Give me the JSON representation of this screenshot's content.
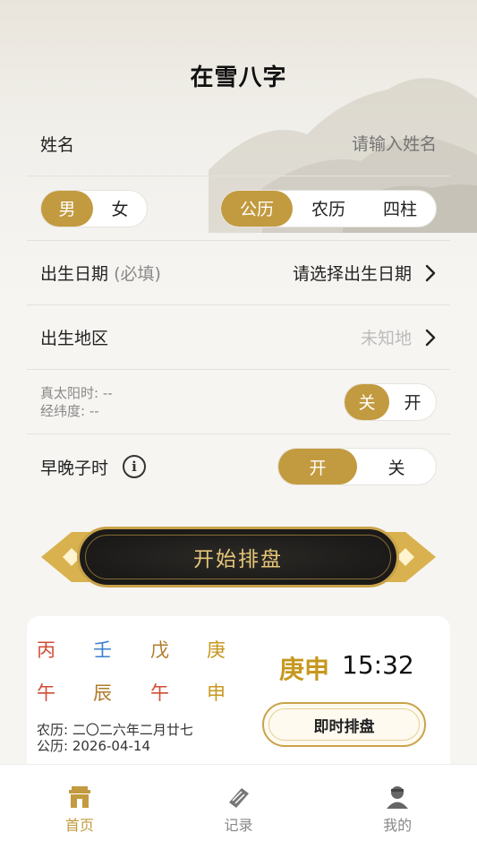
{
  "header": {
    "title": "在雪八字"
  },
  "name_row": {
    "label": "姓名",
    "placeholder": "请输入姓名"
  },
  "gender": {
    "options": [
      "男",
      "女"
    ],
    "selected": "男"
  },
  "calendar": {
    "options": [
      "公历",
      "农历",
      "四柱"
    ],
    "selected": "公历"
  },
  "birth_date": {
    "label": "出生日期",
    "hint": "(必填)",
    "value": "请选择出生日期"
  },
  "birth_region": {
    "label": "出生地区",
    "value": "未知地"
  },
  "solar_time": {
    "line1": "真太阳时: --",
    "line2": "经纬度: --",
    "options": [
      "关",
      "开"
    ],
    "selected": "关"
  },
  "early_late_zi": {
    "label": "早晚子时",
    "info_icon": "i",
    "options": [
      "开",
      "关"
    ],
    "selected": "开"
  },
  "start_button": {
    "label": "开始排盘"
  },
  "current": {
    "stems": [
      "丙",
      "壬",
      "戊",
      "庚"
    ],
    "branches": [
      "午",
      "辰",
      "午",
      "申"
    ],
    "hour_ganzhi": "庚申",
    "time": "15:32",
    "lunar": "农历: 二〇二六年二月廿七",
    "solar": "公历: 2026-04-14",
    "instant_label": "即时排盘"
  },
  "colors": {
    "accent": "#c29a3f",
    "fire": "#d24b35",
    "water": "#3b7fd0",
    "earth": "#b07b2a",
    "metal": "#c7981f"
  },
  "tabbar": {
    "items": [
      {
        "label": "首页",
        "icon": "home-icon",
        "active": true
      },
      {
        "label": "记录",
        "icon": "scroll-icon",
        "active": false
      },
      {
        "label": "我的",
        "icon": "user-icon",
        "active": false
      }
    ]
  }
}
